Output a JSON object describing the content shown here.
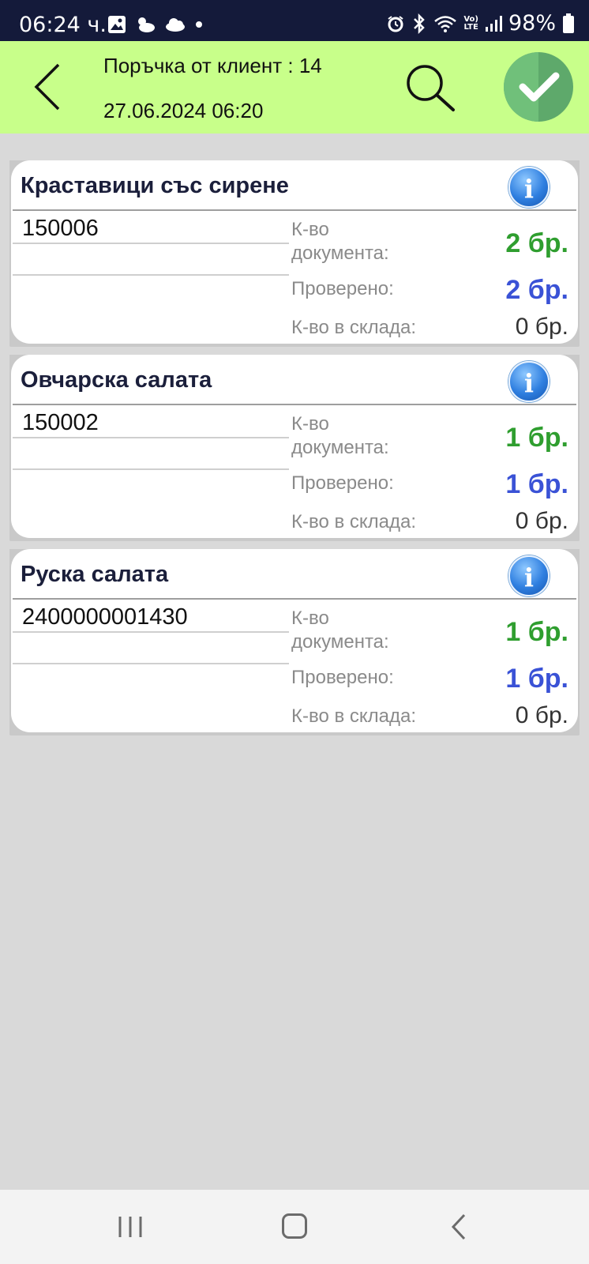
{
  "status_bar": {
    "time": "06:24 ч.",
    "lte_top": "Vo)",
    "lte_bottom": "LTE",
    "battery": "98%"
  },
  "header": {
    "title": "Поръчка от клиент : 14",
    "date": "27.06.2024 06:20"
  },
  "items": [
    {
      "name": "Краставици със сирене",
      "code": "150006",
      "doc_qty_label": "К-во документа:",
      "doc_qty": "2 бр.",
      "checked_label": "Проверено:",
      "checked": "2 бр.",
      "stock_label": "К-во в склада:",
      "stock": "0 бр."
    },
    {
      "name": "Овчарска салата",
      "code": "150002",
      "doc_qty_label": "К-во документа:",
      "doc_qty": "1 бр.",
      "checked_label": "Проверено:",
      "checked": "1 бр.",
      "stock_label": "К-во в склада:",
      "stock": "0 бр."
    },
    {
      "name": "Руска салата",
      "code": "2400000001430",
      "doc_qty_label": "К-во документа:",
      "doc_qty": "1 бр.",
      "checked_label": "Проверено:",
      "checked": "1 бр.",
      "stock_label": "К-во в склада:",
      "stock": "0 бр."
    }
  ],
  "info_glyph": "i",
  "colors": {
    "header_bg": "#c8ff8a",
    "status_bg": "#141a3a",
    "doc_qty": "#2f9e2f",
    "checked": "#3a52d6",
    "confirm": "#5ea96b"
  }
}
